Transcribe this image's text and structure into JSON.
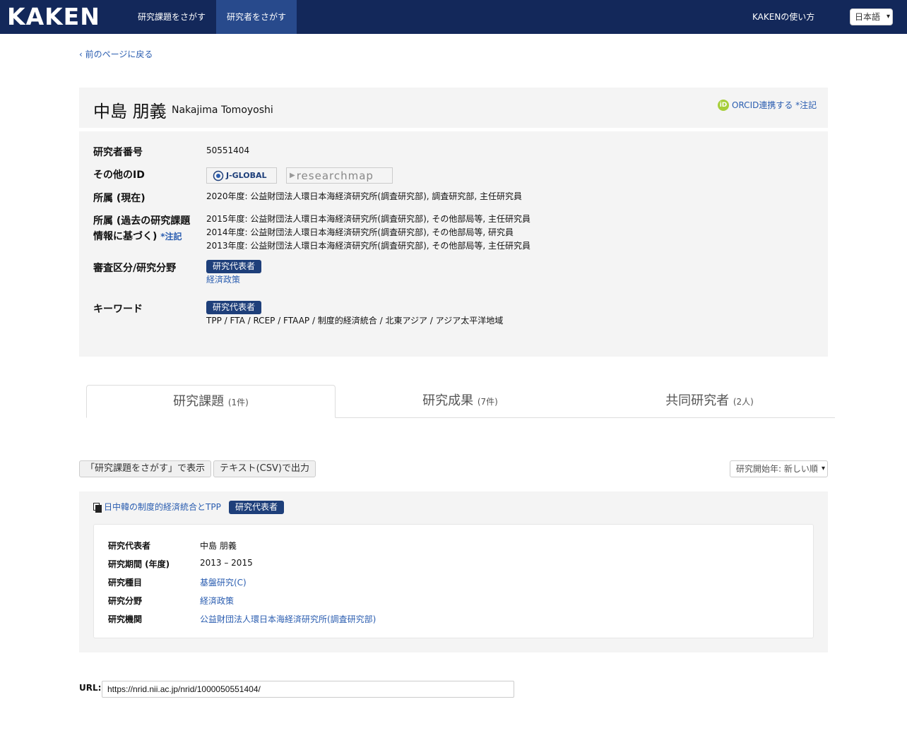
{
  "nav": {
    "logo": "KAKEN",
    "items": [
      "研究課題をさがす",
      "研究者をさがす"
    ],
    "help": "KAKENの使い方",
    "language": "日本語"
  },
  "back_link": "前のページに戻る",
  "researcher": {
    "name_ja": "中島 朋義",
    "name_en": "Nakajima Tomoyoshi",
    "orcid_link": "ORCID連携する *注記"
  },
  "info": {
    "number_label": "研究者番号",
    "number": "50551404",
    "other_id_label": "その他のID",
    "other_ids": [
      "J-GLOBAL",
      "researchmap"
    ],
    "affil_now_label": "所属 (現在)",
    "affil_now": "2020年度: 公益財団法人環日本海経済研究所(調査研究部), 調査研究部, 主任研究員",
    "affil_past_label_1": "所属 (過去の研究課題",
    "affil_past_label_2": "情報に基づく)",
    "affil_past_note": "*注記",
    "affil_past": [
      "2015年度: 公益財団法人環日本海経済研究所(調査研究部), その他部局等, 主任研究員",
      "2014年度: 公益財団法人環日本海経済研究所(調査研究部), その他部局等, 研究員",
      "2013年度: 公益財団法人環日本海経済研究所(調査研究部), その他部局等, 主任研究員"
    ],
    "field_label": "審査区分/研究分野",
    "field_badge": "研究代表者",
    "field_value": "経済政策",
    "keyword_label": "キーワード",
    "keyword_badge": "研究代表者",
    "keywords": "TPP / FTA / RCEP / FTAAP / 制度的経済統合 / 北東アジア / アジア太平洋地域"
  },
  "tabs": [
    {
      "label": "研究課題",
      "count": "(1件)"
    },
    {
      "label": "研究成果",
      "count": "(7件)"
    },
    {
      "label": "共同研究者",
      "count": "(2人)"
    }
  ],
  "buttons": {
    "show": "「研究課題をさがす」で表示",
    "csv": "テキスト(CSV)で出力",
    "sort": "研究開始年: 新しい順"
  },
  "project": {
    "title": "日中韓の制度的経済統合とTPP",
    "badge": "研究代表者",
    "rows": [
      {
        "label": "研究代表者",
        "value": "中島 朋義"
      },
      {
        "label": "研究期間 (年度)",
        "value": "2013 – 2015"
      },
      {
        "label": "研究種目",
        "value": "基盤研究(C)"
      },
      {
        "label": "研究分野",
        "value": "経済政策"
      },
      {
        "label": "研究機関",
        "value": "公益財団法人環日本海経済研究所(調査研究部)"
      }
    ]
  },
  "url": {
    "label": "URL:",
    "value": "https://nrid.nii.ac.jp/nrid/1000050551404/"
  }
}
